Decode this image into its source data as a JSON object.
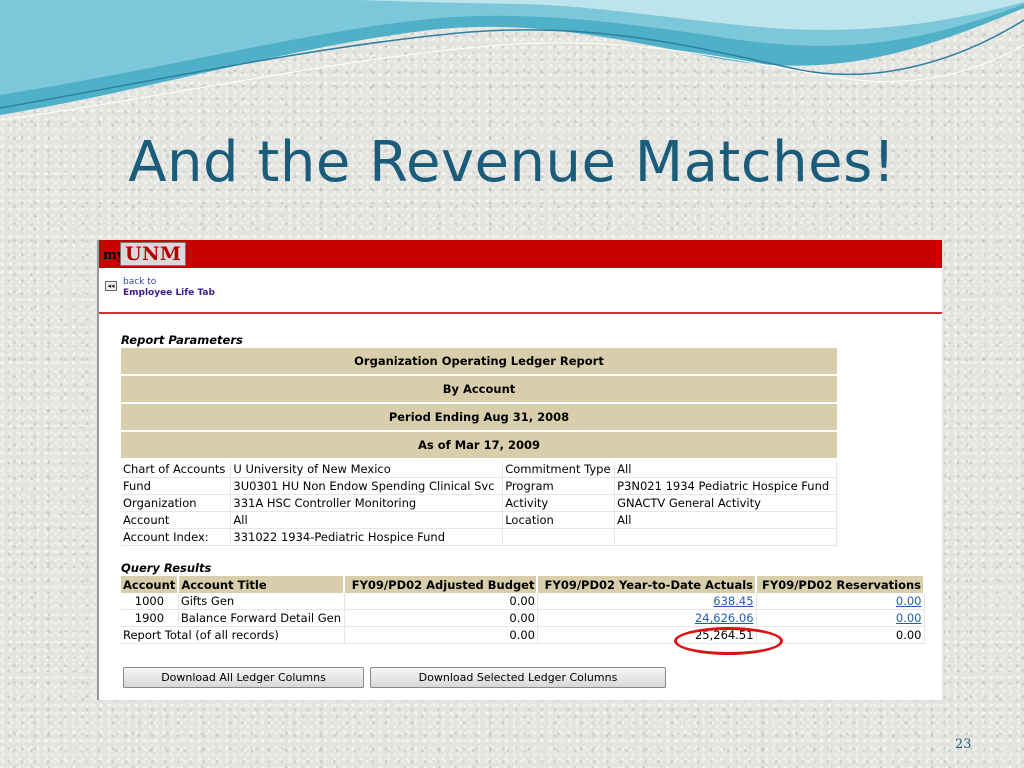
{
  "slide": {
    "title": "And the Revenue Matches!",
    "page_number": "23"
  },
  "app": {
    "logo_prefix": "my",
    "logo_main": "UNM",
    "back_line1": "back to",
    "back_line2": "Employee Life Tab",
    "accent_color": "#c80000"
  },
  "report": {
    "section_title": "Report Parameters",
    "bands": [
      "Organization Operating Ledger Report",
      "By Account",
      "Period Ending Aug 31, 2008",
      "As of Mar 17, 2009"
    ],
    "params": [
      [
        "Chart of Accounts",
        "U University of New Mexico",
        "Commitment Type",
        "All"
      ],
      [
        "Fund",
        "3U0301 HU Non Endow Spending Clinical Svc",
        "Program",
        "P3N021 1934 Pediatric Hospice Fund"
      ],
      [
        "Organization",
        "331A HSC Controller Monitoring",
        "Activity",
        "GNACTV General Activity"
      ],
      [
        "Account",
        "All",
        "Location",
        "All"
      ],
      [
        "Account Index:",
        "331022 1934-Pediatric Hospice Fund",
        "",
        ""
      ]
    ]
  },
  "query": {
    "section_title": "Query Results",
    "headers": [
      "Account",
      "Account Title",
      "FY09/PD02 Adjusted Budget",
      "FY09/PD02 Year-to-Date Actuals",
      "FY09/PD02 Reservations"
    ],
    "rows": [
      {
        "account": "1000",
        "title": "Gifts Gen",
        "budget": "0.00",
        "actuals": "638.45",
        "reservations": "0.00"
      },
      {
        "account": "1900",
        "title": "Balance Forward Detail Gen",
        "budget": "0.00",
        "actuals": "24,626.06",
        "reservations": "0.00"
      }
    ],
    "total": {
      "label": "Report Total (of all records)",
      "budget": "0.00",
      "actuals": "25,264.51",
      "reservations": "0.00"
    },
    "highlight_color": "#dd1111"
  },
  "buttons": {
    "download_all": "Download All Ledger Columns",
    "download_selected": "Download Selected Ledger Columns"
  }
}
